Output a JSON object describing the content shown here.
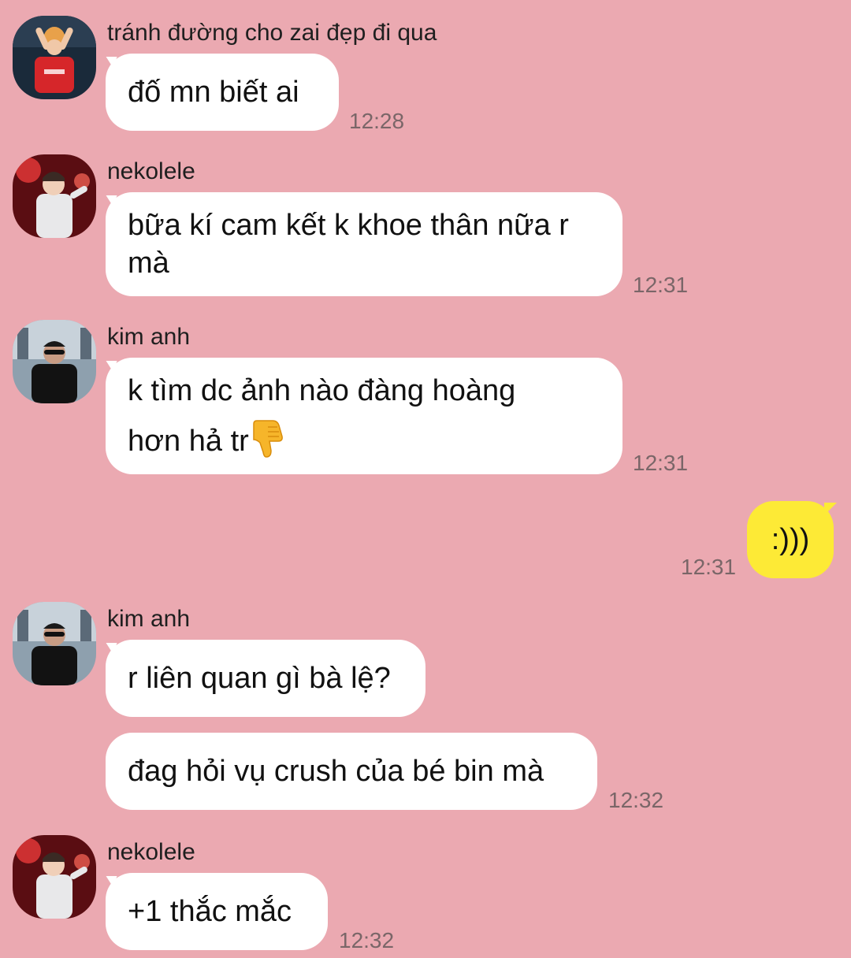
{
  "messages": [
    {
      "sender": "tránh đường cho zai đẹp đi qua",
      "text": "đố mn biết ai",
      "time": "12:28",
      "avatar": "avatar-red-jersey"
    },
    {
      "sender": "nekolele",
      "text_line1": "bữa kí cam kết k khoe thân nữa r",
      "text_line2": "mà",
      "time": "12:31",
      "avatar": "avatar-stage-red"
    },
    {
      "sender": "kim anh",
      "text_line1": "k tìm dc ảnh nào đàng hoàng",
      "text_line2": "hơn hả tr",
      "emoji": "thumbs-down-icon",
      "time": "12:31",
      "avatar": "avatar-stage-dark"
    },
    {
      "text": ":)))",
      "time": "12:31",
      "own": true
    },
    {
      "sender": "kim anh",
      "text": "r liên quan gì bà lệ?",
      "avatar": "avatar-stage-dark"
    },
    {
      "text": "đag hỏi vụ crush của bé bin mà",
      "time": "12:32"
    },
    {
      "sender": "nekolele",
      "text": "+1 thắc mắc",
      "time": "12:32",
      "avatar": "avatar-stage-red"
    }
  ],
  "colors": {
    "background": "#eba9b1",
    "incoming_bubble": "#ffffff",
    "outgoing_bubble": "#fdea36",
    "time_text": "#7a6668"
  }
}
